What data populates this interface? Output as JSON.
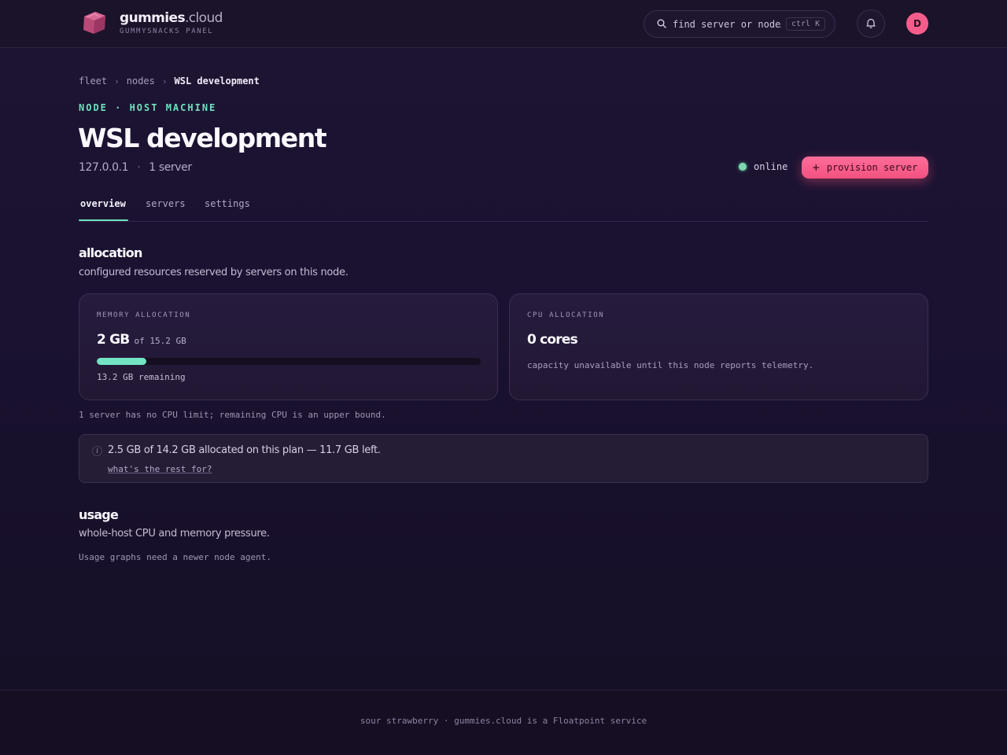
{
  "brand": {
    "name": "gummies",
    "tld": ".cloud",
    "subtitle": "GUMMYSNACKS PANEL"
  },
  "header": {
    "search_placeholder": "find server or node…",
    "search_shortcut": "ctrl K",
    "avatar_initial": "D"
  },
  "breadcrumb": {
    "items": [
      "fleet",
      "nodes",
      "WSL development"
    ],
    "separator": "›"
  },
  "node": {
    "eyebrow": "NODE · HOST MACHINE",
    "title": "WSL development",
    "ip": "127.0.0.1",
    "dot": "·",
    "servers_count": "1 server",
    "status": "online",
    "provision_label": "provision server"
  },
  "tabs": [
    {
      "label": "overview",
      "active": true
    },
    {
      "label": "servers",
      "active": false
    },
    {
      "label": "settings",
      "active": false
    }
  ],
  "allocation": {
    "heading": "allocation",
    "description": "configured resources reserved by servers on this node.",
    "memory": {
      "label": "MEMORY ALLOCATION",
      "value": "2 GB",
      "of": "of 15.2 GB",
      "used_fraction": 0.13,
      "remaining": "13.2 GB remaining"
    },
    "cpu": {
      "label": "CPU ALLOCATION",
      "value": "0 cores",
      "note": "capacity unavailable until this node reports telemetry."
    },
    "footnote": "1 server has no CPU limit; remaining CPU is an upper bound.",
    "info": {
      "icon": "i",
      "text": "2.5 GB of 14.2 GB allocated on this plan — 11.7 GB left.",
      "link": "what's the rest for?"
    }
  },
  "usage": {
    "heading": "usage",
    "description": "whole-host CPU and memory pressure.",
    "note": "Usage graphs need a newer node agent."
  },
  "footer": {
    "text": "sour strawberry · gummies.cloud is a Floatpoint service"
  },
  "colors": {
    "accent_mint": "#6fe0bd",
    "accent_pink": "#f45d8b",
    "background": "#1a1230",
    "card": "#261b3d"
  }
}
